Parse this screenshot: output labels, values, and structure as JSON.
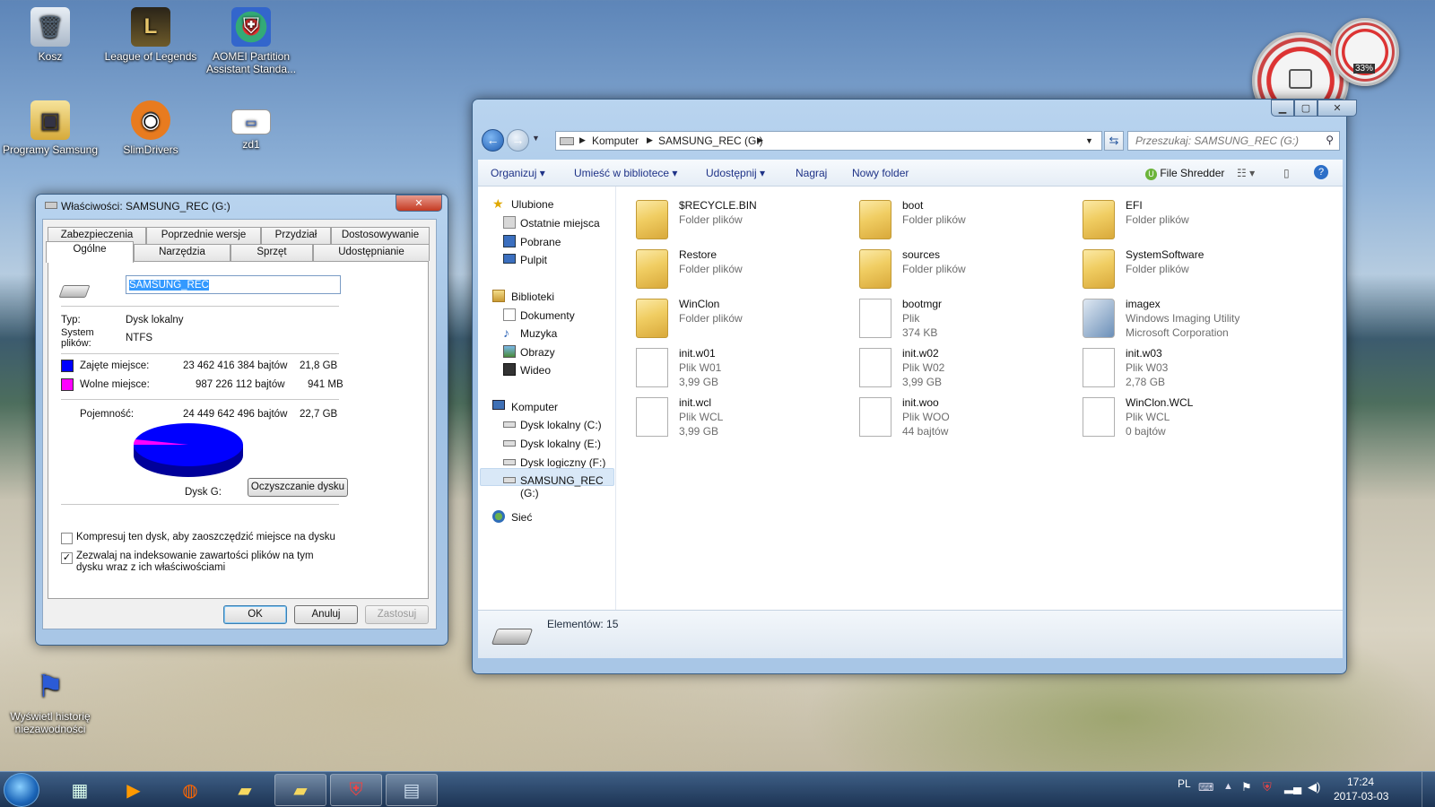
{
  "desktop": {
    "icons": [
      {
        "name": "recycle-bin",
        "label": "Kosz",
        "glyph": "🗑"
      },
      {
        "name": "league-of-legends",
        "label": "League of Legends",
        "glyph": "L"
      },
      {
        "name": "aomei-partition",
        "label": "AOMEI Partition Assistant Standa...",
        "glyph": "⛨"
      },
      {
        "name": "programy-samsung",
        "label": "Programy Samsung",
        "glyph": "▣"
      },
      {
        "name": "slimdrivers",
        "label": "SlimDrivers",
        "glyph": "◉"
      },
      {
        "name": "zd1",
        "label": "zd1",
        "glyph": "▭"
      },
      {
        "name": "reliability-history",
        "label": "Wyświetl historię niezawodności",
        "glyph": "⚑"
      }
    ],
    "gauge_percent": "33%"
  },
  "properties": {
    "title": "Właściwości: SAMSUNG_REC (G:)",
    "close": "✕",
    "tabs_row1": [
      "Zabezpieczenia",
      "Poprzednie wersje",
      "Przydział",
      "Dostosowywanie"
    ],
    "tabs_row2": [
      "Ogólne",
      "Narzędzia",
      "Sprzęt",
      "Udostępnianie"
    ],
    "volume_name": "SAMSUNG_REC",
    "type_label": "Typ:",
    "type_value": "Dysk lokalny",
    "fs_label": "System plików:",
    "fs_value": "NTFS",
    "used_label": "Zajęte miejsce:",
    "used_bytes": "23 462 416 384 bajtów",
    "used_gb": "21,8 GB",
    "free_label": "Wolne miejsce:",
    "free_bytes": "987 226 112 bajtów",
    "free_gb": "941 MB",
    "capacity_label": "Pojemność:",
    "capacity_bytes": "24 449 642 496 bajtów",
    "capacity_gb": "22,7 GB",
    "used_color": "#0000ff",
    "free_color": "#ff00ff",
    "used_fraction": 0.96,
    "drive_label": "Dysk G:",
    "cleanup_button": "Oczyszczanie dysku",
    "compress_label": "Kompresuj ten dysk, aby zaoszczędzić miejsce na dysku",
    "compress_checked": false,
    "index_label": "Zezwalaj na indeksowanie zawartości plików na tym dysku wraz z ich właściwościami",
    "index_checked": true,
    "ok": "OK",
    "cancel": "Anuluj",
    "apply": "Zastosuj"
  },
  "explorer": {
    "breadcrumb": [
      "Komputer",
      "SAMSUNG_REC (G:)"
    ],
    "search_placeholder": "Przeszukaj: SAMSUNG_REC (G:)",
    "toolbar": {
      "organize": "Organizuj",
      "include_library": "Umieść w bibliotece",
      "share": "Udostępnij",
      "burn": "Nagraj",
      "new_folder": "Nowy folder",
      "file_shredder": "File Shredder"
    },
    "nav": {
      "favorites": "Ulubione",
      "recent": "Ostatnie miejsca",
      "downloads": "Pobrane",
      "desktop": "Pulpit",
      "libraries": "Biblioteki",
      "documents": "Dokumenty",
      "music": "Muzyka",
      "pictures": "Obrazy",
      "videos": "Wideo",
      "computer": "Komputer",
      "drive_c": "Dysk lokalny (C:)",
      "drive_e": "Dysk lokalny (E:)",
      "drive_f": "Dysk logiczny (F:)",
      "drive_g": "SAMSUNG_REC (G:)",
      "network": "Sieć"
    },
    "files": [
      {
        "name": "$RECYCLE.BIN",
        "meta1": "Folder plików",
        "meta2": "",
        "kind": "folder"
      },
      {
        "name": "boot",
        "meta1": "Folder plików",
        "meta2": "",
        "kind": "folder"
      },
      {
        "name": "EFI",
        "meta1": "Folder plików",
        "meta2": "",
        "kind": "folder"
      },
      {
        "name": "Restore",
        "meta1": "Folder plików",
        "meta2": "",
        "kind": "folder"
      },
      {
        "name": "sources",
        "meta1": "Folder plików",
        "meta2": "",
        "kind": "folder"
      },
      {
        "name": "SystemSoftware",
        "meta1": "Folder plików",
        "meta2": "",
        "kind": "folder"
      },
      {
        "name": "WinClon",
        "meta1": "Folder plików",
        "meta2": "",
        "kind": "folder"
      },
      {
        "name": "bootmgr",
        "meta1": "Plik",
        "meta2": "374 KB",
        "kind": "file"
      },
      {
        "name": "imagex",
        "meta1": "Windows Imaging Utility",
        "meta2": "Microsoft Corporation",
        "kind": "app"
      },
      {
        "name": "init.w01",
        "meta1": "Plik W01",
        "meta2": "3,99 GB",
        "kind": "file"
      },
      {
        "name": "init.w02",
        "meta1": "Plik W02",
        "meta2": "3,99 GB",
        "kind": "file"
      },
      {
        "name": "init.w03",
        "meta1": "Plik W03",
        "meta2": "2,78 GB",
        "kind": "file"
      },
      {
        "name": "init.wcl",
        "meta1": "Plik WCL",
        "meta2": "3,99 GB",
        "kind": "file"
      },
      {
        "name": "init.woo",
        "meta1": "Plik WOO",
        "meta2": "44 bajtów",
        "kind": "file"
      },
      {
        "name": "WinClon.WCL",
        "meta1": "Plik WCL",
        "meta2": "0 bajtów",
        "kind": "file"
      }
    ],
    "status": "Elementów: 15"
  },
  "taskbar": {
    "lang": "PL",
    "time": "17:24",
    "date": "2017-03-03"
  }
}
